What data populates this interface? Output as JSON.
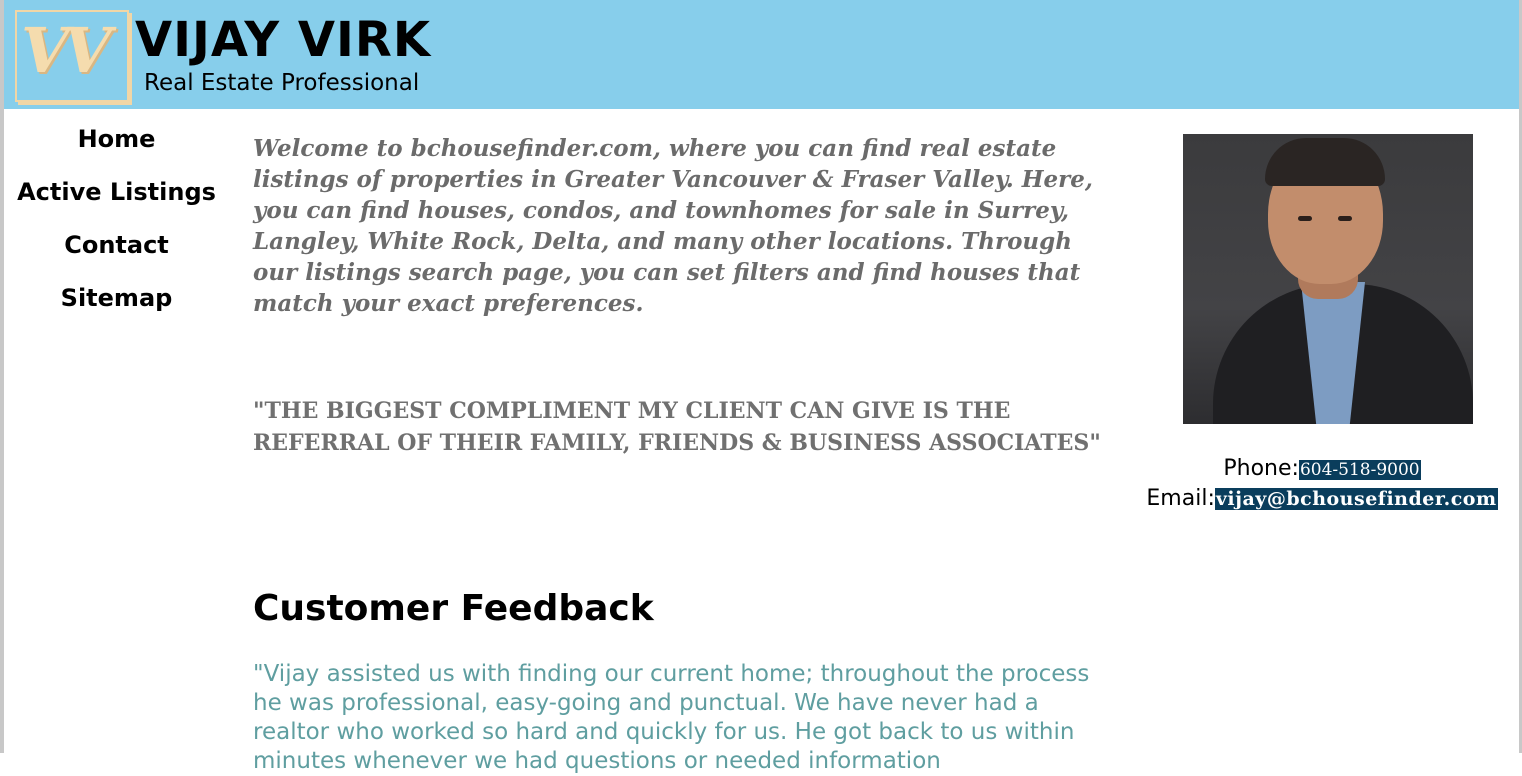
{
  "header": {
    "logo_text": "VV",
    "name": "VIJAY VIRK",
    "tagline": "Real Estate Professional"
  },
  "nav": {
    "items": [
      {
        "label": "Home"
      },
      {
        "label": "Active Listings"
      },
      {
        "label": "Contact"
      },
      {
        "label": "Sitemap"
      }
    ]
  },
  "main": {
    "intro": "Welcome to bchousefinder.com, where you can find real estate listings of properties in Greater Vancouver & Fraser Valley. Here, you can find houses, condos, and townhomes for sale in Surrey, Langley, White Rock, Delta, and many other locations. Through our listings search page, you can set filters and find houses that match your exact preferences.",
    "quote": "\"THE BIGGEST COMPLIMENT MY CLIENT CAN GIVE IS THE REFERRAL OF THEIR FAMILY, FRIENDS & BUSINESS ASSOCIATES\"",
    "feedback_heading": "Customer Feedback",
    "feedback_text": "\"Vijay assisted us with finding our current home; throughout the process he was professional, easy-going and punctual. We have never had a realtor who worked so hard and quickly for us. He got back to us within minutes whenever we had questions or needed information"
  },
  "contact": {
    "phone_label": "Phone:",
    "phone": "604-518-9000",
    "email_label": "Email:",
    "email": "vijay@bchousefinder.com"
  },
  "colors": {
    "header_bg": "#87ceeb",
    "contact_highlight": "#0a3d5c",
    "feedback_text": "#5f9ea0",
    "logo": "#f5dcae"
  }
}
